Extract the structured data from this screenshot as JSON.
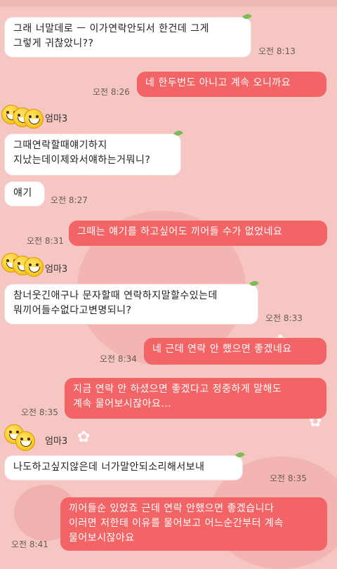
{
  "sender_name": "엄마3",
  "messages": [
    {
      "side": "in",
      "text": "그래 너말데로 ㅡ 이가연락안되서 한건데 그게\n그렇게 귀찮았니??",
      "time": "오전 8:13"
    },
    {
      "side": "out",
      "text": "네 한두번도 아니고 계속 오니까요",
      "time": "오전 8:26"
    },
    {
      "side": "in",
      "text": "그때연락할때얘기하지\n지났는데이제와서얘하는거뭐니?",
      "time": ""
    },
    {
      "side": "in",
      "text": "얘기",
      "time": "오전 8:27"
    },
    {
      "side": "out",
      "text": "그때는 얘기를 하고싶어도 끼어들 수가 없었네요",
      "time": "오전 8:31"
    },
    {
      "side": "in",
      "text": "참너웃긴애구나 문자할때 연락하지말할수있는데\n뭐끼어들수없다고변명되니?",
      "time": "오전 8:33"
    },
    {
      "side": "out",
      "text": "네 근데 연락 안 했으면 좋겠네요",
      "time": "오전 8:34"
    },
    {
      "side": "out",
      "text": "지금 연락 안 하셨으면 좋겠다고 정중하게 말해도\n계속 물어보시잖아요...",
      "time": "오전 8:35"
    },
    {
      "side": "in",
      "text": "나도하고싶지않은데 너가말안되소리해서보내",
      "time": "오전 8:35"
    },
    {
      "side": "out",
      "text": "끼어들순 있었죠 근데 연락 안했으면 좋겠습니다\n이러면 저한테 이유를 물어보고 어느순간부터 계속\n물어보시잖아요",
      "time": "오전 8:41"
    }
  ]
}
